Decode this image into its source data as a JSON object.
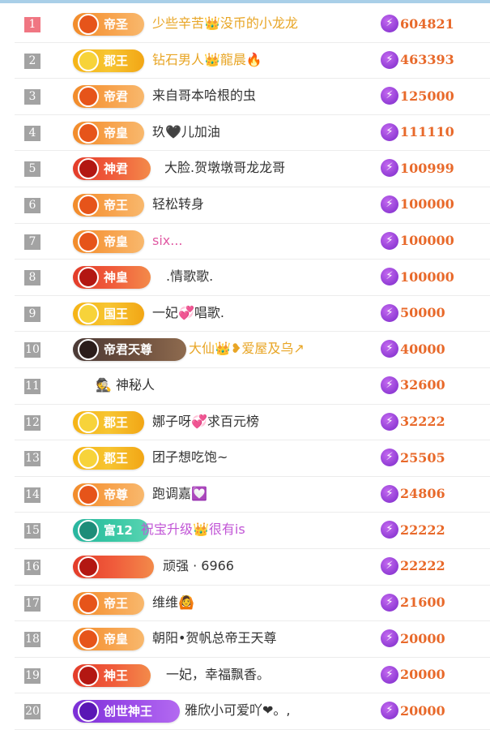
{
  "rows": [
    {
      "rank": "1",
      "badge": "帝圣",
      "badge_style": "b-orange",
      "name": "少些辛苦👑没币的小龙龙",
      "name_color": "gold",
      "score": "604821"
    },
    {
      "rank": "2",
      "badge": "郡王",
      "badge_style": "b-gold",
      "name": "钻石男人👑龍晨🔥",
      "name_color": "gold",
      "score": "463393"
    },
    {
      "rank": "3",
      "badge": "帝君",
      "badge_style": "b-orange",
      "name": "来自哥本哈根的虫",
      "name_color": "normal",
      "score": "125000"
    },
    {
      "rank": "4",
      "badge": "帝皇",
      "badge_style": "b-orange",
      "name": "玖🖤儿加油",
      "name_color": "normal",
      "score": "111110"
    },
    {
      "rank": "5",
      "badge": "神君",
      "badge_style": "b-red",
      "name": "大脸.贺墩墩哥龙龙哥",
      "name_color": "normal",
      "score": "100999"
    },
    {
      "rank": "6",
      "badge": "帝王",
      "badge_style": "b-orange",
      "name": "轻松转身",
      "name_color": "normal",
      "score": "100000"
    },
    {
      "rank": "7",
      "badge": "帝皇",
      "badge_style": "b-orange",
      "name": "six...",
      "name_color": "pink",
      "score": "100000"
    },
    {
      "rank": "8",
      "badge": "神皇",
      "badge_style": "b-red",
      "name": ".情歌歌.",
      "name_color": "normal",
      "score": "100000"
    },
    {
      "rank": "9",
      "badge": "国王",
      "badge_style": "b-gold",
      "name": "一妃💞唱歌.",
      "name_color": "normal",
      "score": "50000"
    },
    {
      "rank": "10",
      "badge": "帝君天尊",
      "badge_style": "b-dark",
      "name": "大仙👑❥爱屋及乌↗",
      "name_color": "gold",
      "score": "40000"
    },
    {
      "rank": "11",
      "badge": "",
      "badge_style": "",
      "name": "🕵 神秘人",
      "name_color": "normal",
      "score": "32600"
    },
    {
      "rank": "12",
      "badge": "郡王",
      "badge_style": "b-gold",
      "name": "娜子呀💞求百元榜",
      "name_color": "normal",
      "score": "32222"
    },
    {
      "rank": "13",
      "badge": "郡王",
      "badge_style": "b-gold",
      "name": "团子想吃饱~",
      "name_color": "normal",
      "score": "25505"
    },
    {
      "rank": "14",
      "badge": "帝尊",
      "badge_style": "b-orange",
      "name": "跑调嘉💟",
      "name_color": "normal",
      "score": "24806"
    },
    {
      "rank": "15",
      "badge": "富12",
      "badge_style": "b-teal",
      "name": "祝宝升级👑很有is",
      "name_color": "purple",
      "score": "22222"
    },
    {
      "rank": "16",
      "badge": "",
      "badge_style": "b-red",
      "name": "顽强 · 6966",
      "name_color": "normal",
      "score": "22222"
    },
    {
      "rank": "17",
      "badge": "帝王",
      "badge_style": "b-orange",
      "name": "维维🙆",
      "name_color": "normal",
      "score": "21600"
    },
    {
      "rank": "18",
      "badge": "帝皇",
      "badge_style": "b-orange",
      "name": "朝阳•贺帆总帝王天尊",
      "name_color": "normal",
      "score": "20000"
    },
    {
      "rank": "19",
      "badge": "神王",
      "badge_style": "b-red",
      "name": "一妃，幸福飘香。",
      "name_color": "normal",
      "score": "20000"
    },
    {
      "rank": "20",
      "badge": "创世神王",
      "badge_style": "b-purple",
      "name": "雅欣小可爱吖❤。,",
      "name_color": "normal",
      "score": "20000"
    }
  ],
  "icons": {
    "score": "lightning-bolt-icon",
    "badge_emblem": "crest-icon"
  },
  "colors": {
    "accent": "#e8692a",
    "rank_first": "#f07682",
    "rank_default": "#a3a3a3",
    "bolt": "#8f3fd9"
  }
}
